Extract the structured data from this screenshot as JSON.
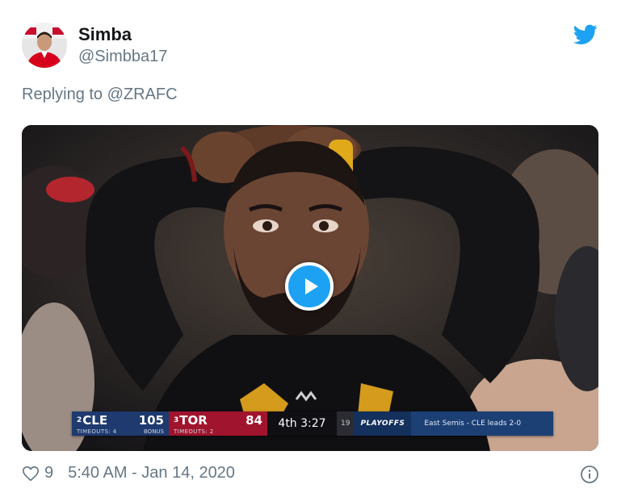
{
  "author": {
    "display_name": "Simba",
    "handle": "@Simbba17"
  },
  "reply": {
    "prefix": "Replying to ",
    "mention": "@ZRAFC"
  },
  "media": {
    "type": "video",
    "scorebug": {
      "away_seed": "2",
      "away_abbr": "CLE",
      "away_score": "105",
      "away_timeouts": "TIMEOUTS: 4",
      "away_bonus": "BONUS",
      "home_seed": "3",
      "home_abbr": "TOR",
      "home_score": "84",
      "home_timeouts": "TIMEOUTS: 2",
      "clock": "4th 3:27",
      "shot_clock": "19",
      "league_badge": "PLAYOFFS",
      "series_status": "East Semis - CLE leads 2-0"
    }
  },
  "footer": {
    "likes": "9",
    "timestamp": "5:40 AM - Jan 14, 2020"
  },
  "colors": {
    "brand_blue": "#1da1f2",
    "secondary_text": "#657786",
    "primary_text": "#14171a",
    "cle_navy": "#1e3a6e",
    "tor_red": "#a0142d"
  },
  "icons": {
    "brand": "twitter-bird-icon",
    "play": "play-icon",
    "like": "heart-icon",
    "info": "info-icon"
  }
}
